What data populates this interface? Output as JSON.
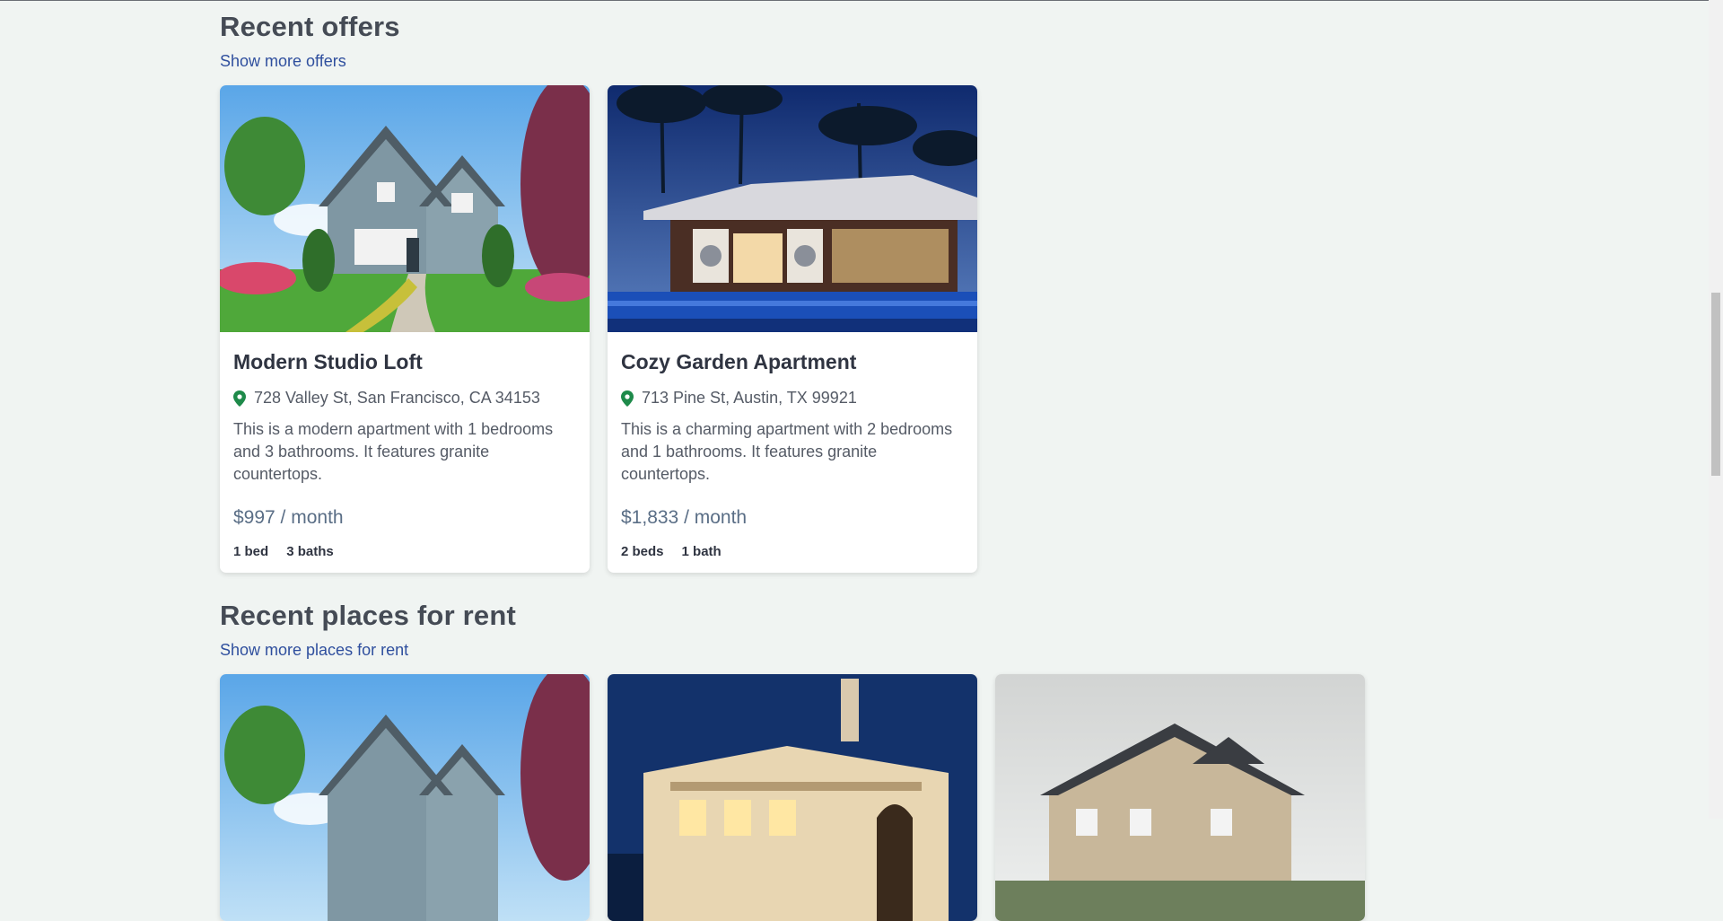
{
  "offers": {
    "title": "Recent offers",
    "link": "Show more offers",
    "cards": [
      {
        "title": "Modern Studio Loft",
        "address": "728 Valley St, San Francisco, CA 34153",
        "description": "This is a modern apartment with 1 bedrooms and 3 bathrooms. It features granite countertops.",
        "price": "$997 / month",
        "beds": "1 bed",
        "baths": "3 baths",
        "image": "craftsman-house-photo"
      },
      {
        "title": "Cozy Garden Apartment",
        "address": "713 Pine St, Austin, TX 99921",
        "description": "This is a charming apartment with 2 bedrooms and 1 bathrooms. It features granite countertops.",
        "price": "$1,833 / month",
        "beds": "2 beds",
        "baths": "1 bath",
        "image": "tropical-villa-pool-photo"
      }
    ]
  },
  "rent": {
    "title": "Recent places for rent",
    "link": "Show more places for rent",
    "cards": [
      {
        "image": "craftsman-house-photo"
      },
      {
        "image": "luxury-villa-night-photo"
      },
      {
        "image": "large-manor-house-photo"
      }
    ]
  },
  "colors": {
    "background": "#f0f4f2",
    "link": "#2f4f9e",
    "pin": "#1e8a4a",
    "price": "#5a6e86"
  },
  "icons": {
    "location": "map-pin-icon"
  }
}
